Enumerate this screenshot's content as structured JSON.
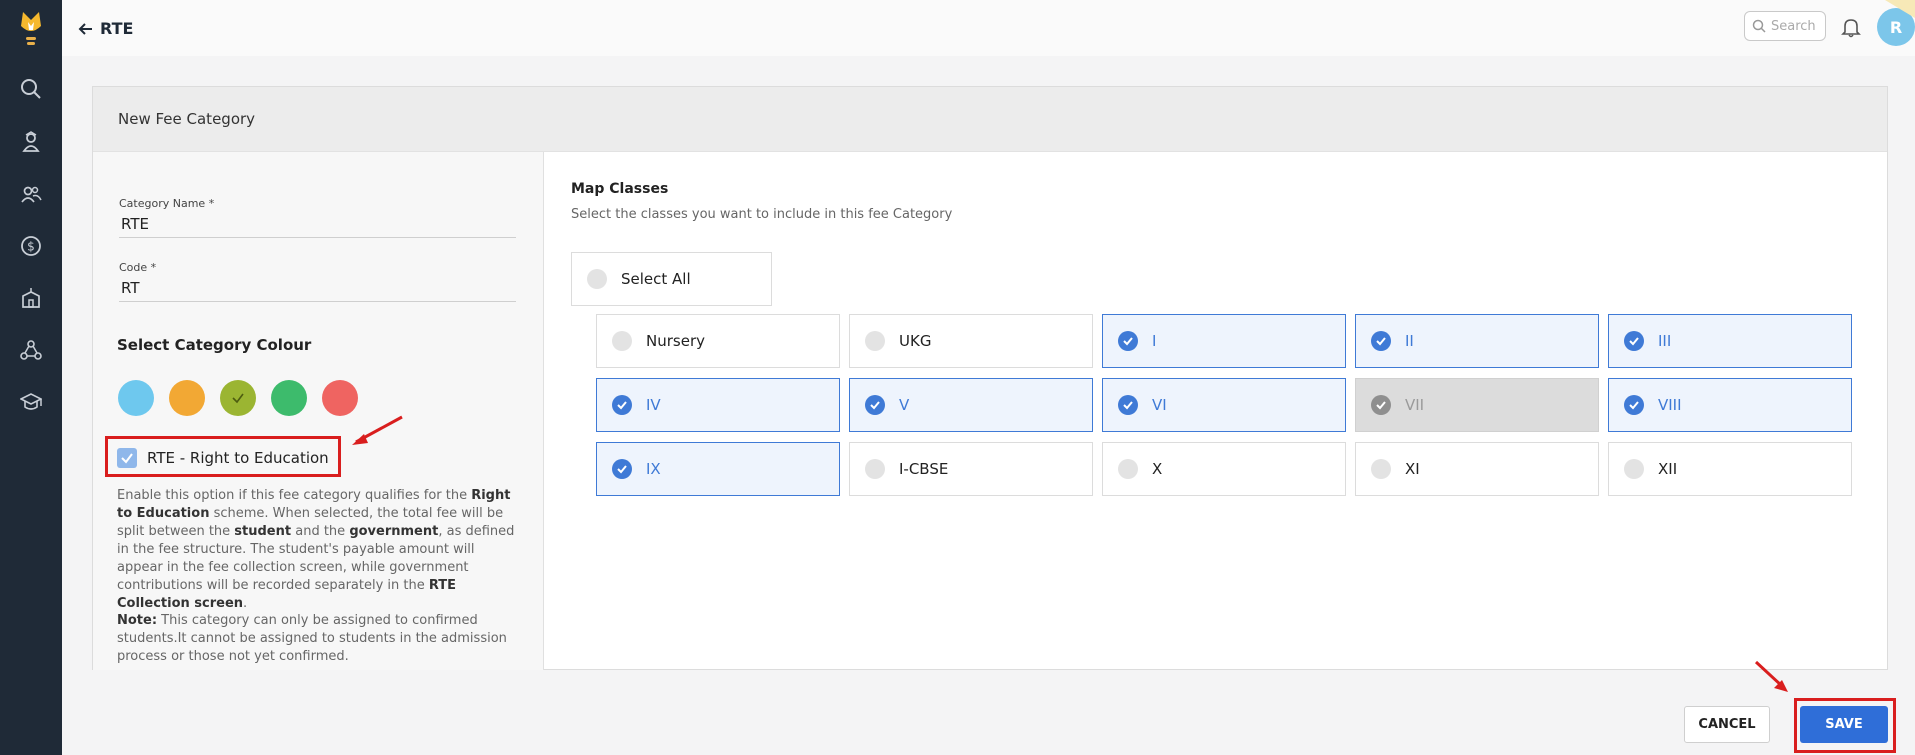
{
  "header": {
    "title": "RTE",
    "search_placeholder": "Search",
    "avatar_initial": "R"
  },
  "sidebar": {
    "icons": [
      "logo-icon",
      "search-icon",
      "student-icon",
      "people-icon",
      "fees-icon",
      "school-icon",
      "network-icon",
      "graduation-icon"
    ]
  },
  "form": {
    "card_title": "New Fee Category",
    "category_name_label": "Category Name *",
    "category_name_value": "RTE",
    "code_label": "Code *",
    "code_value": "RT",
    "colour_title": "Select Category Colour",
    "colours": [
      "#6ec8ee",
      "#f2a834",
      "#9bb532",
      "#3dbb6c",
      "#ef6461"
    ],
    "selected_colour_index": 2,
    "rte_label": "RTE - Right to Education",
    "rte_checked": true,
    "desc_1": "Enable this option if this fee category qualifies for the ",
    "desc_b1": "Right to Education",
    "desc_2": " scheme. When selected, the total fee will be split between the ",
    "desc_b2": "student",
    "desc_3": " and the ",
    "desc_b3": "government",
    "desc_4": ", as defined in the fee structure. The student's payable amount will appear in the fee collection screen, while government contributions will be recorded separately in the ",
    "desc_b4": "RTE Collection screen",
    "desc_5": ".",
    "note_label": "Note:",
    "note_text": " This category can only be assigned to confirmed students.It cannot be assigned to students in the admission process or those not yet confirmed."
  },
  "map_classes": {
    "title": "Map Classes",
    "subtitle": "Select the classes you want to include in this fee Category",
    "select_all_label": "Select All",
    "classes": [
      {
        "label": "Nursery",
        "state": "unchecked"
      },
      {
        "label": "UKG",
        "state": "unchecked"
      },
      {
        "label": "I",
        "state": "checked"
      },
      {
        "label": "II",
        "state": "checked"
      },
      {
        "label": "III",
        "state": "checked"
      },
      {
        "label": "IV",
        "state": "checked"
      },
      {
        "label": "V",
        "state": "checked"
      },
      {
        "label": "VI",
        "state": "checked"
      },
      {
        "label": "VII",
        "state": "disabled"
      },
      {
        "label": "VIII",
        "state": "checked"
      },
      {
        "label": "IX",
        "state": "checked"
      },
      {
        "label": "I-CBSE",
        "state": "unchecked"
      },
      {
        "label": "X",
        "state": "unchecked"
      },
      {
        "label": "XI",
        "state": "unchecked"
      },
      {
        "label": "XII",
        "state": "unchecked"
      }
    ]
  },
  "footer": {
    "cancel_label": "CANCEL",
    "save_label": "SAVE"
  },
  "colors": {
    "sidebar_bg": "#1f2a37",
    "accent": "#2f6ed8",
    "annotation_red": "#d91e1e"
  }
}
